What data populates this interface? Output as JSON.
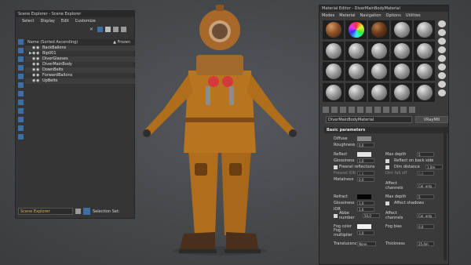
{
  "scene_explorer": {
    "title": "Scene Explorer - Scene Explorer",
    "menu": [
      "Select",
      "Display",
      "Edit",
      "Customize"
    ],
    "list_header": {
      "name": "Name (Sorted Ascending)",
      "frozen": "▲ Frozen"
    },
    "items": [
      {
        "label": "BackBallons",
        "expander": ""
      },
      {
        "label": "Bip001",
        "expander": "▶"
      },
      {
        "label": "DiverGlasses",
        "expander": ""
      },
      {
        "label": "DiverMainBody",
        "expander": ""
      },
      {
        "label": "DownBelts",
        "expander": ""
      },
      {
        "label": "ForwardBallons",
        "expander": ""
      },
      {
        "label": "UpBelts",
        "expander": ""
      }
    ],
    "footer": {
      "dropdown": "Scene Explorer",
      "selection_set": "Selection Set:"
    }
  },
  "material_editor": {
    "title": "Material Editor - DiverMainBodyMaterial",
    "menu": [
      "Modes",
      "Material",
      "Navigation",
      "Options",
      "Utilities"
    ],
    "material_name": "DiverMainBodyMaterial",
    "material_type": "VRayMtl",
    "section_basic": "Basic parameters",
    "diffuse": {
      "label": "Diffuse",
      "color": "#8a8a8a"
    },
    "roughness_top": {
      "label": "Roughness",
      "value": "0,0"
    },
    "reflect": {
      "label": "Reflect",
      "color": "#e6e6e6"
    },
    "max_depth": {
      "label": "Max depth",
      "value": "5"
    },
    "glossiness": {
      "label": "Glossiness",
      "value": "1,0"
    },
    "reflect_backside": "Reflect on back side",
    "fresnel": "Fresnel reflections",
    "dim_distance": {
      "label": "Dim distance",
      "value": "1,0m"
    },
    "fresnel_ior": {
      "label": "Fresnel IOR",
      "value": "1,6"
    },
    "dim_falloff": {
      "label": "Dim fall off",
      "value": "0,0"
    },
    "metalness": {
      "label": "Metalness",
      "value": "0,0"
    },
    "affect_channels_1": {
      "label": "Affect channels",
      "value": "Col. only"
    },
    "refract": {
      "label": "Refract",
      "color": "#050505"
    },
    "refract_max_depth": {
      "label": "Max depth",
      "value": "5"
    },
    "glossiness2": {
      "label": "Glossiness",
      "value": "1,0"
    },
    "affect_shadows": "Affect shadows",
    "ior": {
      "label": "IOR",
      "value": "1,6"
    },
    "abbe": {
      "label": "Abbe number",
      "value": "50,0"
    },
    "affect_channels_2": {
      "label": "Affect channels",
      "value": "Col. only"
    },
    "fog_color": {
      "label": "Fog color",
      "color": "#f2f2f2"
    },
    "fog_bias": {
      "label": "Fog bias",
      "value": "0,0"
    },
    "fog_multiplier": {
      "label": "Fog multiplier",
      "value": "1,0"
    },
    "translucency": {
      "label": "Translucency",
      "value": "None"
    },
    "thickness": {
      "label": "Thickness",
      "value": "25,4m"
    }
  },
  "colors": {
    "suit": "#b8741e",
    "helmet": "#a8682a",
    "balloon": "#d43a3a",
    "accent": "#3d6ea6"
  }
}
